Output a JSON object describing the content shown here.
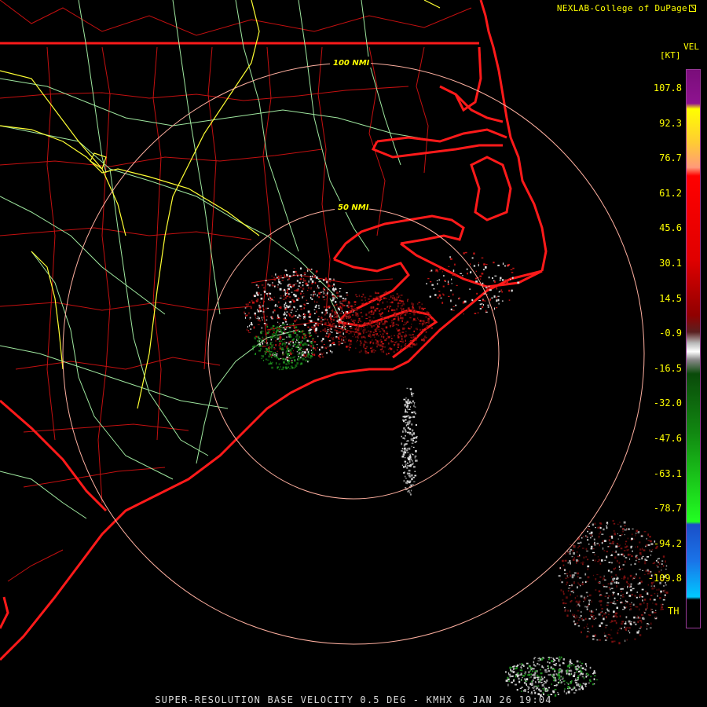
{
  "header": {
    "credit": "NEXLAB-College of DuPage",
    "credit_icon": "external-link-icon"
  },
  "legend": {
    "product": "VEL",
    "unit": "[KT]",
    "ticks": [
      "107.8",
      "92.3",
      "76.7",
      "61.2",
      "45.6",
      "30.1",
      "14.5",
      "-0.9",
      "-16.5",
      "-32.0",
      "-47.6",
      "-63.1",
      "-78.7",
      "-94.2",
      "-109.8"
    ],
    "tick_values": [
      107.8,
      92.3,
      76.7,
      61.2,
      45.6,
      30.1,
      14.5,
      -0.9,
      -16.5,
      -32.0,
      -47.6,
      -63.1,
      -78.7,
      -94.2,
      -109.8
    ],
    "th_label": "TH",
    "gradient": [
      {
        "stop": 0.0,
        "color": "#7a0d7a"
      },
      {
        "stop": 0.06,
        "color": "#8e1390"
      },
      {
        "stop": 0.07,
        "color": "#ffff00"
      },
      {
        "stop": 0.13,
        "color": "#ffcc33"
      },
      {
        "stop": 0.175,
        "color": "#ff9a7a"
      },
      {
        "stop": 0.19,
        "color": "#ff0000"
      },
      {
        "stop": 0.34,
        "color": "#e00000"
      },
      {
        "stop": 0.44,
        "color": "#900000"
      },
      {
        "stop": 0.47,
        "color": "#5a2020"
      },
      {
        "stop": 0.49,
        "color": "#bbbbbb"
      },
      {
        "stop": 0.505,
        "color": "#ffffff"
      },
      {
        "stop": 0.52,
        "color": "#888888"
      },
      {
        "stop": 0.545,
        "color": "#0a4a0a"
      },
      {
        "stop": 0.65,
        "color": "#118811"
      },
      {
        "stop": 0.81,
        "color": "#22ff22"
      },
      {
        "stop": 0.815,
        "color": "#1a4fc8"
      },
      {
        "stop": 0.88,
        "color": "#1a73e8"
      },
      {
        "stop": 0.945,
        "color": "#00c8ff"
      },
      {
        "stop": 0.95,
        "color": "#000000"
      },
      {
        "stop": 1.0,
        "color": "#000000"
      }
    ]
  },
  "map": {
    "radar_site": "KMHX",
    "range_rings": [
      {
        "label": "50 NMI",
        "nmi": 50
      },
      {
        "label": "100 NMI",
        "nmi": 100
      }
    ],
    "colors": {
      "coast_state": "#ff1a1a",
      "counties": "#c41010",
      "highways_green": "#9fe79f",
      "highways_yellow": "#ffff33",
      "rings": "#ffb0a0",
      "background": "#000000",
      "echo_red": "#c41414",
      "echo_white": "#dcdcdc",
      "echo_green": "#1f8f1f"
    }
  },
  "footer": {
    "caption": "SUPER-RESOLUTION BASE VELOCITY 0.5 DEG - KMHX 6 JAN 26 19:04"
  }
}
